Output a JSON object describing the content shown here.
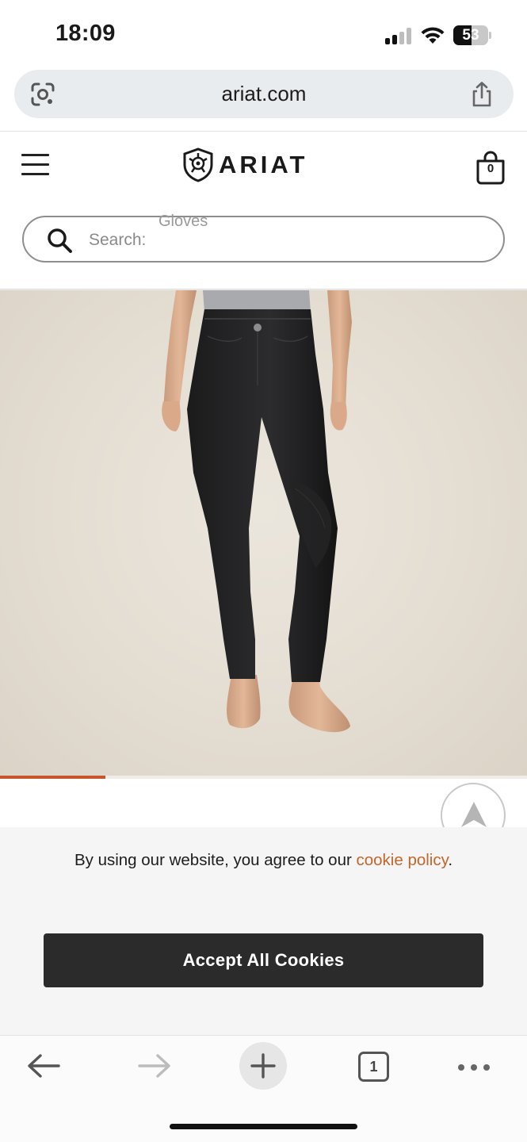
{
  "status_bar": {
    "time": "18:09",
    "battery_level": "53",
    "icons": [
      "cellular-signal-icon",
      "wifi-icon",
      "battery-icon"
    ]
  },
  "browser": {
    "url": "ariat.com",
    "lens_icon": "google-lens-icon",
    "share_icon": "share-icon"
  },
  "header": {
    "menu_icon": "hamburger-menu-icon",
    "logo_text": "ARIAT",
    "logo_trademark": "·",
    "bag_count": "0"
  },
  "search": {
    "placeholder": "Search:",
    "suggestion": "Gloves",
    "icon": "magnifier-icon"
  },
  "product_gallery": {
    "image_subject": "model wearing black full-seat riding tights",
    "progress_fraction": 0.2
  },
  "cookie_banner": {
    "text": "By using our website, you agree to our",
    "link_text": "cookie policy",
    "suffix": ".",
    "accept_label": "Accept All Cookies"
  },
  "toolbar": {
    "back_icon": "back-arrow-icon",
    "forward_icon": "forward-arrow-icon",
    "new_tab_icon": "plus-icon",
    "tabs_count": "1",
    "more_icon": "more-dots-icon"
  },
  "colors": {
    "accent": "#c4562a",
    "button_dark": "#2b2b2b",
    "banner_bg": "#f5f5f5"
  }
}
